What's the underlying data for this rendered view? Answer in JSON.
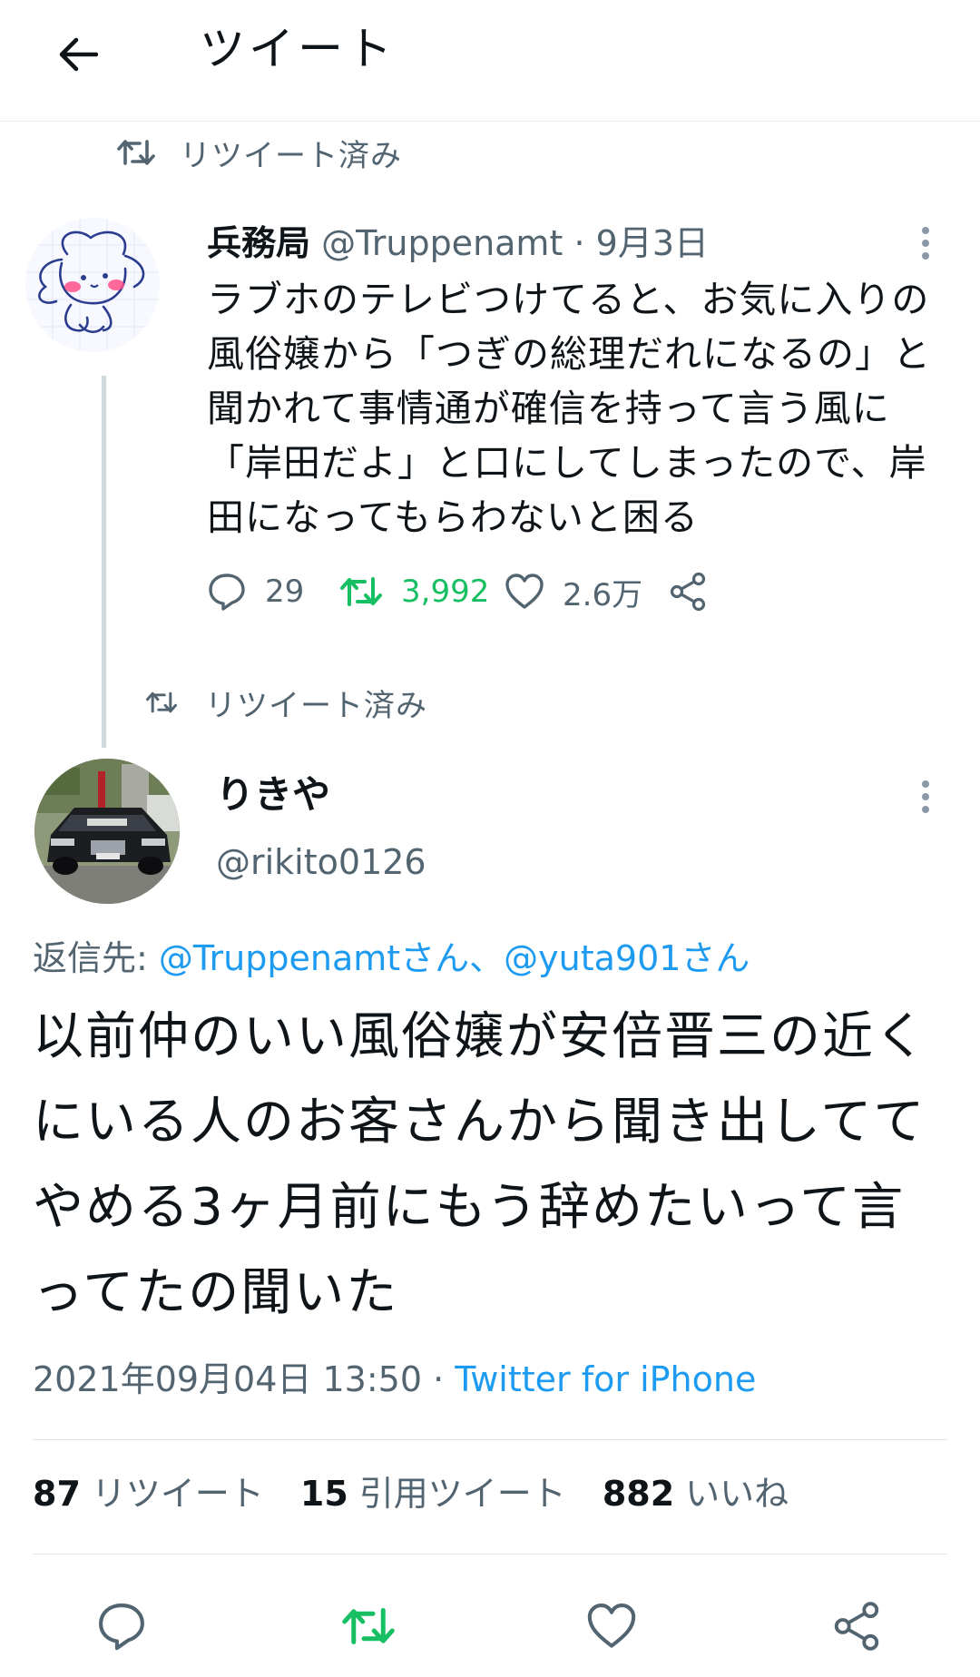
{
  "header": {
    "back_icon": "arrow-left-icon",
    "title": "ツイート"
  },
  "tweet1": {
    "retweet_context": "リツイート済み",
    "name": "兵務局",
    "handle": "@Truppenamt",
    "dot": "·",
    "date": "9月3日",
    "text": "ラブホのテレビつけてると、お気に入りの風俗嬢から「つぎの総理だれになるの」と聞かれて事情通が確信を持って言う風に「岸田だよ」と口にしてしまったので、岸田になってもらわないと困る",
    "actions": {
      "reply_count": "29",
      "retweet_count": "3,992",
      "like_count": "2.6万"
    },
    "retweet_color": "#17bf63"
  },
  "tweet2": {
    "retweet_context": "リツイート済み",
    "name": "りきや",
    "handle": "@rikito0126",
    "reply_prefix": "返信先:",
    "reply_targets": "@Truppenamtさん、@yuta901さん",
    "text": "以前仲のいい風俗嬢が安倍晋三の近くにいる人のお客さんから聞き出しててやめる3ヶ月前にもう辞めたいって言ってたの聞いた",
    "timestamp": "2021年09月04日 13:50",
    "dot": "·",
    "source": "Twitter for iPhone",
    "stats": {
      "retweets_num": "87",
      "retweets_label": "リツイート",
      "quotes_num": "15",
      "quotes_label": "引用ツイート",
      "likes_num": "882",
      "likes_label": "いいね"
    }
  },
  "colors": {
    "link": "#1d9bf0",
    "secondary_text": "#536471",
    "retweet_green": "#17bf63"
  }
}
